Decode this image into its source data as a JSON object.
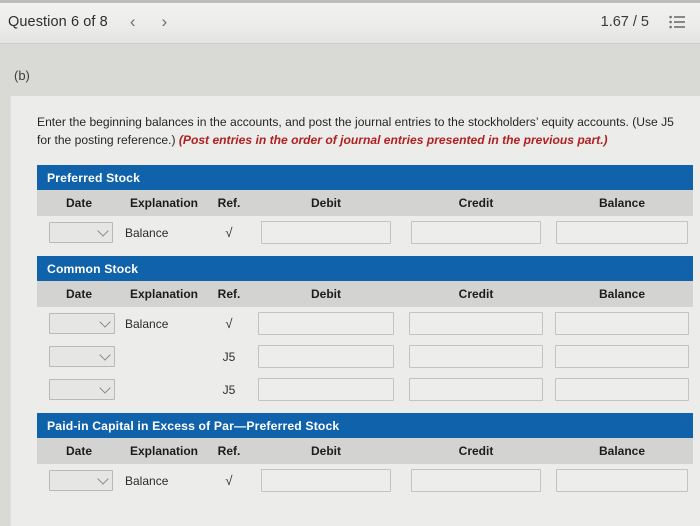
{
  "topbar": {
    "question_label": "Question 6 of 8",
    "prev_arrow": "‹",
    "next_arrow": "›",
    "score": "1.67 / 5",
    "list_icon_name": "list-icon"
  },
  "part": {
    "label": "(b)"
  },
  "instructions": {
    "main": "Enter the beginning balances in the accounts, and post the journal entries to the stockholders’ equity accounts. (Use J5 for the posting reference.) ",
    "emphasis": "(Post entries in the order of journal entries presented in the previous part.)"
  },
  "colors": {
    "header_blue": "#1062ab",
    "column_header_gray": "#d3d3d1",
    "page_background": "#d9d9d6",
    "card_background": "#ececea",
    "emphasis_red": "#b02020"
  },
  "columns": [
    "Date",
    "Explanation",
    "Ref.",
    "Debit",
    "Credit",
    "Balance"
  ],
  "ledgers": [
    {
      "title": "Preferred Stock",
      "rows": [
        {
          "date": "",
          "explanation": "Balance",
          "ref": "√",
          "debit": "",
          "credit": "",
          "balance": ""
        }
      ]
    },
    {
      "title": "Common Stock",
      "rows": [
        {
          "date": "",
          "explanation": "Balance",
          "ref": "√",
          "debit": "",
          "credit": "",
          "balance": ""
        },
        {
          "date": "",
          "explanation": "",
          "ref": "J5",
          "debit": "",
          "credit": "",
          "balance": ""
        },
        {
          "date": "",
          "explanation": "",
          "ref": "J5",
          "debit": "",
          "credit": "",
          "balance": ""
        }
      ]
    },
    {
      "title": "Paid-in Capital in Excess of Par—Preferred Stock",
      "rows": [
        {
          "date": "",
          "explanation": "Balance",
          "ref": "√",
          "debit": "",
          "credit": "",
          "balance": ""
        }
      ]
    }
  ]
}
